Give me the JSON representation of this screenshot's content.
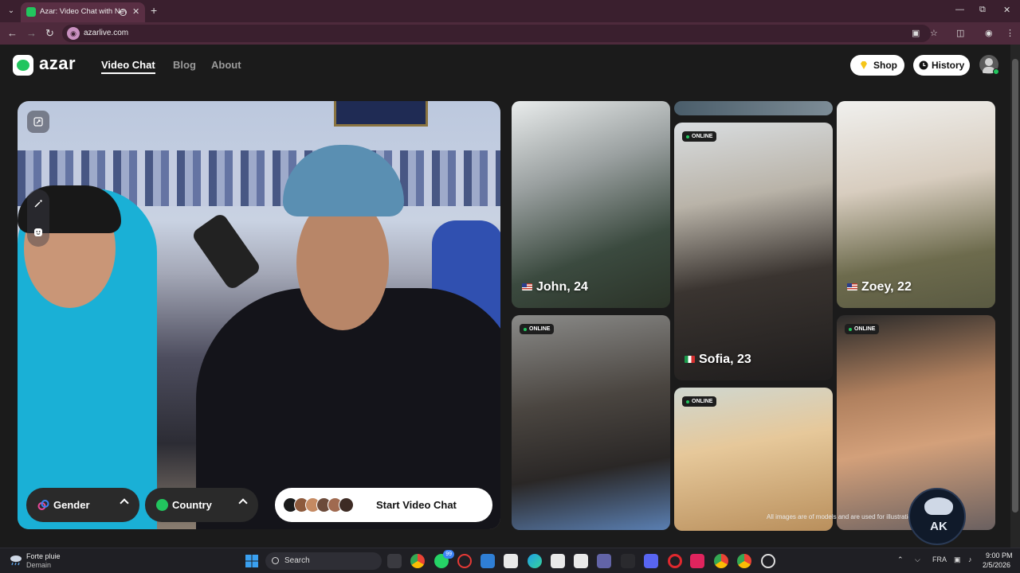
{
  "browser": {
    "tab_title": "Azar: Video Chat with New",
    "url": "azarlive.com"
  },
  "header": {
    "logo_text": "azar",
    "nav": [
      {
        "label": "Video Chat",
        "active": true
      },
      {
        "label": "Blog",
        "active": false
      },
      {
        "label": "About",
        "active": false
      }
    ],
    "shop_label": "Shop",
    "history_label": "History"
  },
  "video_panel": {
    "gender_label": "Gender",
    "country_label": "Country",
    "start_label": "Start Video Chat"
  },
  "cards": [
    {
      "name": "John, 24",
      "flag": "us",
      "online": false
    },
    {
      "name": "Sofia, 23",
      "flag": "it",
      "online": true
    },
    {
      "name": "Zoey, 22",
      "flag": "us",
      "online": false
    },
    {
      "online_label": "ONLINE"
    },
    {
      "online_label": "ONLINE"
    },
    {
      "online_label": "ONLINE"
    }
  ],
  "online_label": "ONLINE",
  "disclaimer": "All images are of models and are used for illustration purposes only.",
  "watermark_text": "AK",
  "taskbar": {
    "weather_line1": "Forte pluie",
    "weather_line2": "Demain",
    "search_label": "Search",
    "whatsapp_badge": "99",
    "lang": "FRA",
    "time": "9:00 PM",
    "date": "2/5/2026"
  },
  "colors": {
    "brand_green": "#22c55e",
    "page_bg": "#1b1b1b",
    "browser_frame": "#3a1f2e"
  }
}
